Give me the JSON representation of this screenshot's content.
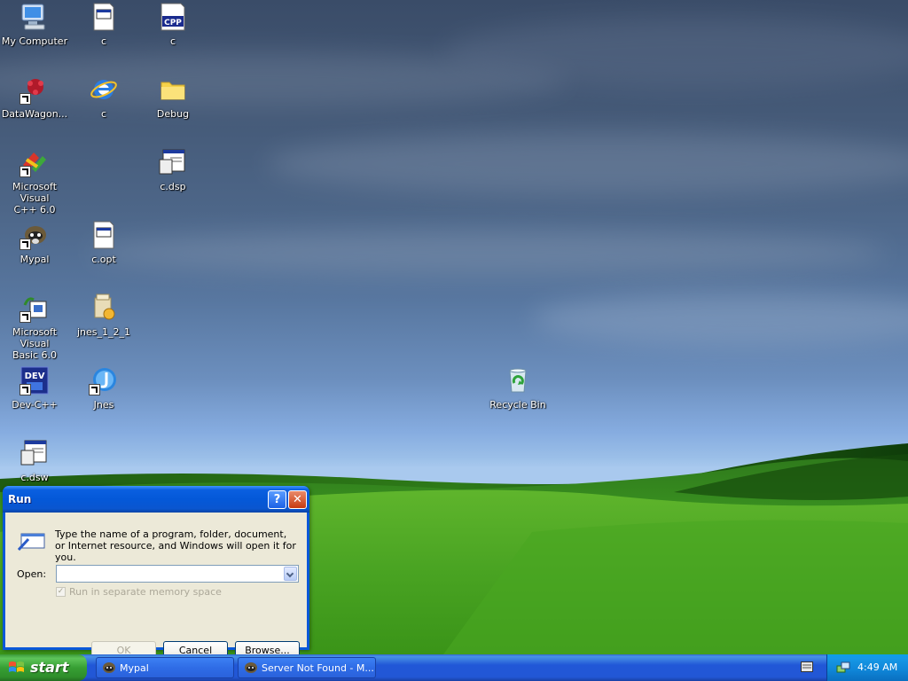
{
  "desktop": {
    "icons": {
      "my_computer": "My Computer",
      "c_file1": "c",
      "c_cpp": "c",
      "datawagon": "DataWagon...",
      "c_ie": "c",
      "debug": "Debug",
      "msvc": "Microsoft Visual\nC++ 6.0",
      "c_dsp": "c.dsp",
      "mypal": "Mypal",
      "c_opt": "c.opt",
      "msvb": "Microsoft Visual\nBasic 6.0",
      "jnes_zip": "jnes_1_2_1",
      "devcpp": "Dev-C++",
      "jnes": "Jnes",
      "c_dsw": "c.dsw",
      "recycle_bin": "Recycle Bin"
    },
    "cpp_badge": "CPP",
    "dev_badge": "DEV"
  },
  "run_dialog": {
    "title": "Run",
    "help_glyph": "?",
    "close_glyph": "✕",
    "description": "Type the name of a program, folder, document, or Internet resource, and Windows will open it for you.",
    "open_label": "Open:",
    "open_value": "",
    "separate_memory_label": "Run in separate memory space",
    "separate_memory_checked": true,
    "ok_label": "OK",
    "cancel_label": "Cancel",
    "browse_label": "Browse..."
  },
  "taskbar": {
    "start_label": "start",
    "tasks": [
      "Mypal",
      "Server Not Found - M..."
    ],
    "clock": "4:49 AM"
  }
}
